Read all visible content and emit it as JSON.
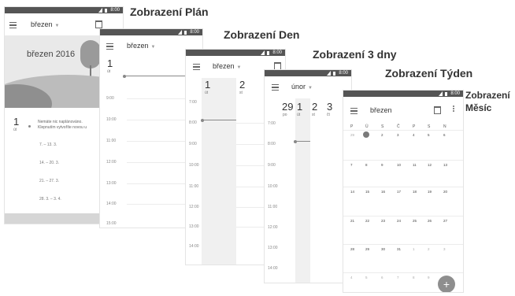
{
  "status_bar": {
    "time": "8:00"
  },
  "screens": {
    "plan": {
      "title": "Zobrazení Plán",
      "month": "březen",
      "banner": "březen 2016",
      "day_num": "1",
      "day_name": "út",
      "event_line1": "Nemáte nic naplánováno.",
      "event_line2": "Klepnutím vytvoříte novou u",
      "weeks": [
        "7. – 13. 3.",
        "14. – 20. 3.",
        "21. – 27. 3.",
        "28. 3. – 3. 4."
      ]
    },
    "day": {
      "title": "Zobrazení Den",
      "month": "březen",
      "day_num": "1",
      "day_name": "út",
      "hours": [
        "9:00",
        "10:00",
        "11:00",
        "12:00",
        "13:00",
        "14:00",
        "15:00"
      ]
    },
    "three_day": {
      "title": "Zobrazení 3 dny",
      "month": "březen",
      "days": [
        {
          "num": "1",
          "name": "út"
        },
        {
          "num": "2",
          "name": "st"
        }
      ],
      "hours": [
        "7:00",
        "8:00",
        "9:00",
        "10:00",
        "11:00",
        "12:00",
        "13:00",
        "14:00"
      ]
    },
    "week": {
      "title": "Zobrazení Týden",
      "month": "únor",
      "days": [
        {
          "num": "29",
          "name": "po"
        },
        {
          "num": "1",
          "name": "út"
        },
        {
          "num": "2",
          "name": "st"
        },
        {
          "num": "3",
          "name": "čt"
        }
      ],
      "hours": [
        "7:00",
        "8:00",
        "9:00",
        "10:00",
        "11:00",
        "12:00",
        "13:00",
        "14:00"
      ]
    },
    "month": {
      "title_line1": "Zobrazení",
      "title_line2": "Měsíc",
      "month": "březen",
      "weekdays": [
        "P",
        "Ú",
        "S",
        "Č",
        "P",
        "S",
        "N"
      ],
      "weeks": [
        [
          "29",
          "1",
          "2",
          "3",
          "4",
          "5",
          "6"
        ],
        [
          "7",
          "8",
          "9",
          "10",
          "11",
          "12",
          "13"
        ],
        [
          "14",
          "15",
          "16",
          "17",
          "18",
          "19",
          "20"
        ],
        [
          "21",
          "22",
          "23",
          "24",
          "25",
          "26",
          "27"
        ],
        [
          "28",
          "29",
          "30",
          "31",
          "1",
          "2",
          "3"
        ],
        [
          "4",
          "5",
          "6",
          "7",
          "8",
          "9",
          "10"
        ]
      ],
      "fab_label": "+"
    }
  }
}
